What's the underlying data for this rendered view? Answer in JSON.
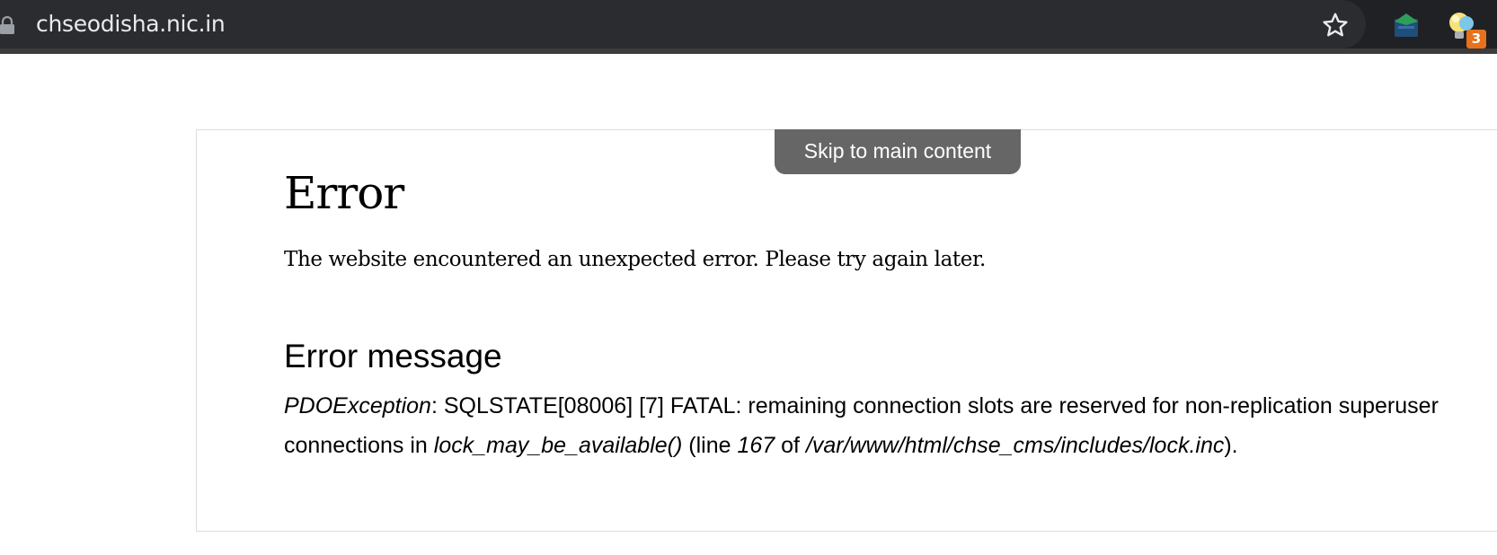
{
  "browser": {
    "url": "chseodisha.nic.in",
    "icons": {
      "lock": "lock-icon",
      "star": "star-icon",
      "extension1": "graduation-cap-icon",
      "extension2": "lightbulb-icon"
    },
    "extension_badge": "3"
  },
  "page": {
    "skip_link": "Skip to main content",
    "title": "Error",
    "subtitle": "The website encountered an unexpected error. Please try again later.",
    "error_heading": "Error message",
    "error": {
      "exception": "PDOException",
      "text_1": ": SQLSTATE[08006] [7] FATAL: remaining connection slots are reserved for non-replication superuser connections in ",
      "function": "lock_may_be_available()",
      "text_2": " (line ",
      "line": "167",
      "text_3": " of ",
      "file": "/var/www/html/chse_cms/includes/lock.inc",
      "text_4": ")."
    }
  }
}
